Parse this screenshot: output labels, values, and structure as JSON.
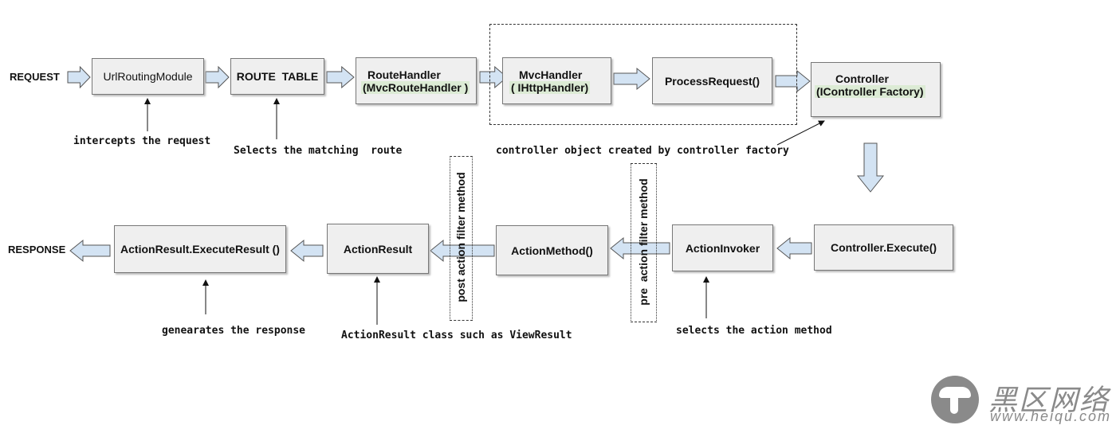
{
  "terminals": {
    "request": "REQUEST",
    "response": "RESPONSE"
  },
  "boxes": {
    "url_routing_module": "UrlRoutingModule",
    "route_table": "ROUTE  TABLE",
    "route_handler": {
      "title": "RouteHandler",
      "sub": "(MvcRouteHandler )"
    },
    "mvc_handler": {
      "title": "MvcHandler",
      "sub": "( IHttpHandler)"
    },
    "process_request": "ProcessRequest()",
    "controller": {
      "title": "Controller",
      "sub": "(IController Factory)"
    },
    "controller_execute": "Controller.Execute()",
    "action_invoker": "ActionInvoker",
    "action_method": "ActionMethod()",
    "action_result": "ActionResult",
    "execute_result": "ActionResult.ExecuteResult ()"
  },
  "filters": {
    "post": "post action filter method",
    "pre": "pre  action filter method"
  },
  "annotations": {
    "intercepts": "intercepts the request",
    "selects_route": "Selects the matching  route",
    "controller_created": "controller object created by controller factory",
    "generates_response": "genearates the response",
    "action_result_class": "ActionResult class such as ViewResult",
    "selects_action": "selects the action method"
  },
  "watermark": {
    "name": "黑区网络",
    "url": "www.heiqu.com"
  },
  "colors": {
    "arrow_fill": "#d3e3f3",
    "arrow_stroke": "#555555",
    "box_fill": "#efefef",
    "highlight": "#dcebd5"
  }
}
